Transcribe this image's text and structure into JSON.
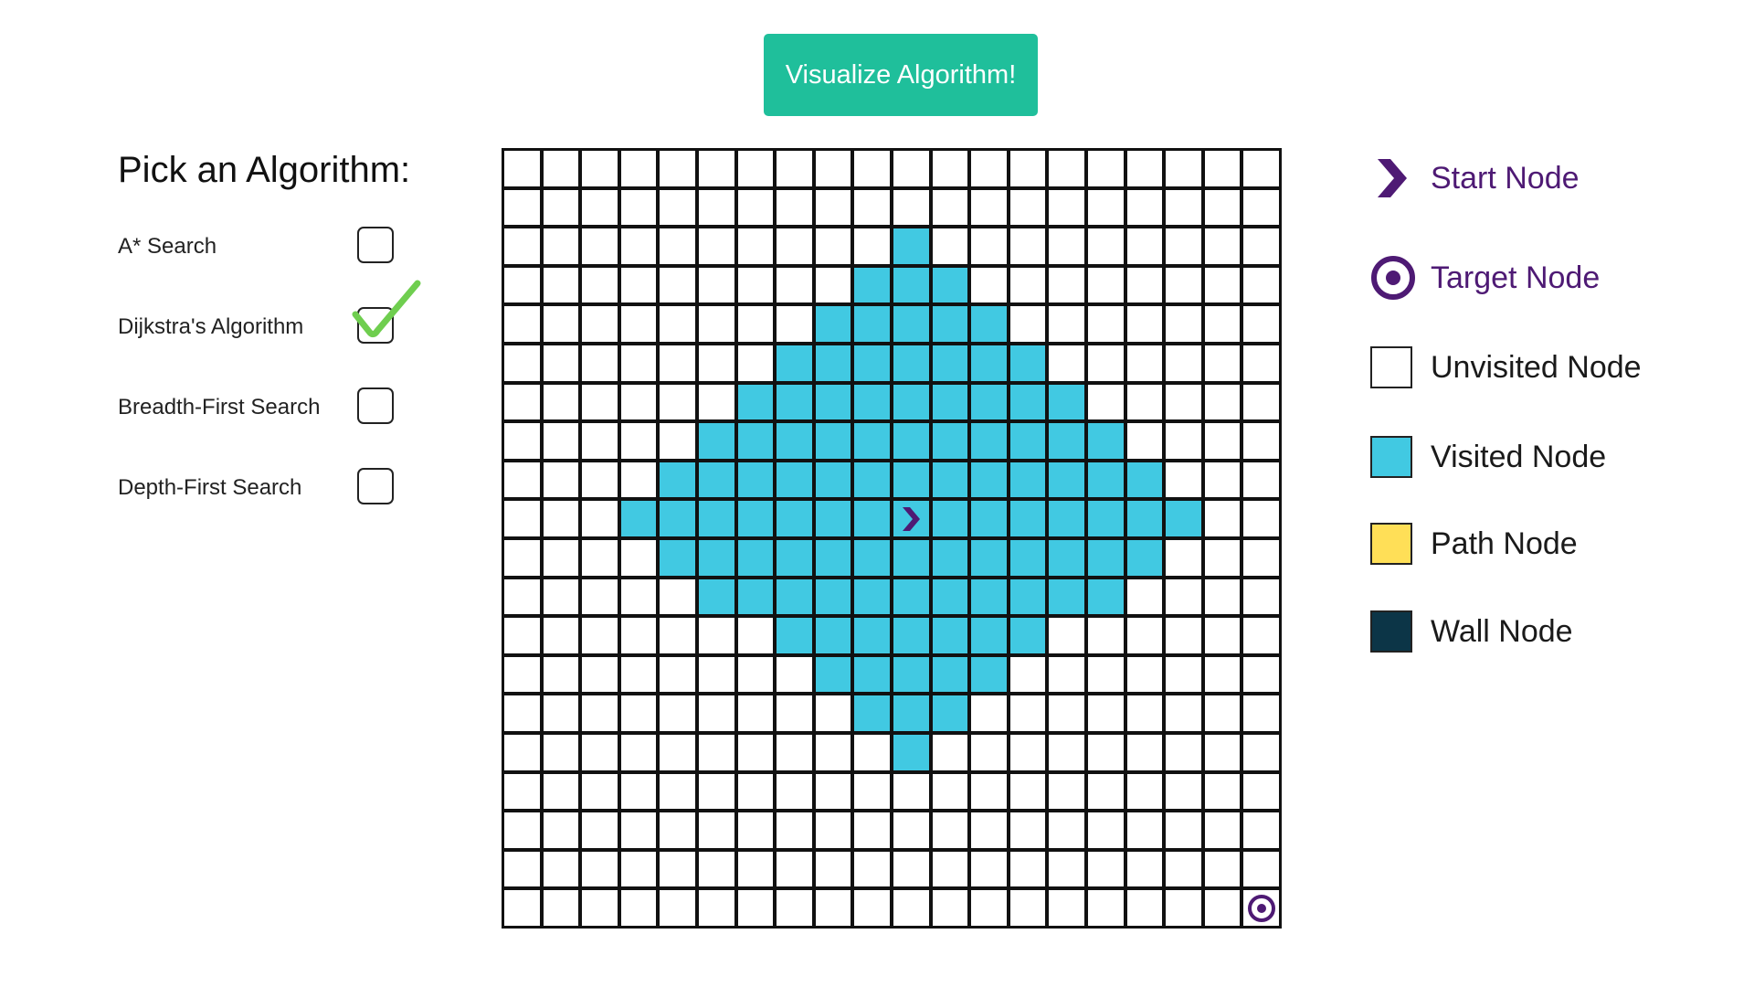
{
  "header": {
    "visualize_label": "Visualize Algorithm!"
  },
  "algorithms": {
    "title": "Pick an Algorithm:",
    "items": [
      {
        "label": "A* Search",
        "checked": false
      },
      {
        "label": "Dijkstra's Algorithm",
        "checked": true
      },
      {
        "label": "Breadth-First Search",
        "checked": false
      },
      {
        "label": "Depth-First Search",
        "checked": false
      }
    ]
  },
  "grid": {
    "rows": 20,
    "cols": 20,
    "start": [
      9,
      10
    ],
    "target": [
      19,
      19
    ],
    "visited_cells": [
      [
        2,
        10
      ],
      [
        3,
        9
      ],
      [
        3,
        10
      ],
      [
        3,
        11
      ],
      [
        4,
        8
      ],
      [
        4,
        9
      ],
      [
        4,
        10
      ],
      [
        4,
        11
      ],
      [
        4,
        12
      ],
      [
        5,
        7
      ],
      [
        5,
        8
      ],
      [
        5,
        9
      ],
      [
        5,
        10
      ],
      [
        5,
        11
      ],
      [
        5,
        12
      ],
      [
        5,
        13
      ],
      [
        6,
        6
      ],
      [
        6,
        7
      ],
      [
        6,
        8
      ],
      [
        6,
        9
      ],
      [
        6,
        10
      ],
      [
        6,
        11
      ],
      [
        6,
        12
      ],
      [
        6,
        13
      ],
      [
        6,
        14
      ],
      [
        7,
        5
      ],
      [
        7,
        6
      ],
      [
        7,
        7
      ],
      [
        7,
        8
      ],
      [
        7,
        9
      ],
      [
        7,
        10
      ],
      [
        7,
        11
      ],
      [
        7,
        12
      ],
      [
        7,
        13
      ],
      [
        7,
        14
      ],
      [
        7,
        15
      ],
      [
        8,
        4
      ],
      [
        8,
        5
      ],
      [
        8,
        6
      ],
      [
        8,
        7
      ],
      [
        8,
        8
      ],
      [
        8,
        9
      ],
      [
        8,
        10
      ],
      [
        8,
        11
      ],
      [
        8,
        12
      ],
      [
        8,
        13
      ],
      [
        8,
        14
      ],
      [
        8,
        15
      ],
      [
        8,
        16
      ],
      [
        9,
        3
      ],
      [
        9,
        4
      ],
      [
        9,
        5
      ],
      [
        9,
        6
      ],
      [
        9,
        7
      ],
      [
        9,
        8
      ],
      [
        9,
        9
      ],
      [
        9,
        10
      ],
      [
        9,
        11
      ],
      [
        9,
        12
      ],
      [
        9,
        13
      ],
      [
        9,
        14
      ],
      [
        9,
        15
      ],
      [
        9,
        16
      ],
      [
        9,
        17
      ],
      [
        10,
        4
      ],
      [
        10,
        5
      ],
      [
        10,
        6
      ],
      [
        10,
        7
      ],
      [
        10,
        8
      ],
      [
        10,
        9
      ],
      [
        10,
        10
      ],
      [
        10,
        11
      ],
      [
        10,
        12
      ],
      [
        10,
        13
      ],
      [
        10,
        14
      ],
      [
        10,
        15
      ],
      [
        10,
        16
      ],
      [
        11,
        5
      ],
      [
        11,
        6
      ],
      [
        11,
        7
      ],
      [
        11,
        8
      ],
      [
        11,
        9
      ],
      [
        11,
        10
      ],
      [
        11,
        11
      ],
      [
        11,
        12
      ],
      [
        11,
        13
      ],
      [
        11,
        14
      ],
      [
        11,
        15
      ],
      [
        12,
        7
      ],
      [
        12,
        8
      ],
      [
        12,
        9
      ],
      [
        12,
        10
      ],
      [
        12,
        11
      ],
      [
        12,
        12
      ],
      [
        12,
        13
      ],
      [
        13,
        8
      ],
      [
        13,
        9
      ],
      [
        13,
        10
      ],
      [
        13,
        11
      ],
      [
        13,
        12
      ],
      [
        14,
        9
      ],
      [
        14,
        10
      ],
      [
        14,
        11
      ],
      [
        15,
        10
      ]
    ],
    "path_cells": [],
    "wall_cells": []
  },
  "legend": {
    "items": [
      {
        "label": "Start Node",
        "kind": "start",
        "icon": "chevron-right-icon"
      },
      {
        "label": "Target Node",
        "kind": "target",
        "icon": "target-icon"
      },
      {
        "label": "Unvisited Node",
        "kind": "unvisited",
        "color": "#ffffff"
      },
      {
        "label": "Visited Node",
        "kind": "visited",
        "color": "#41c9e2"
      },
      {
        "label": "Path Node",
        "kind": "path",
        "color": "#ffdf57"
      },
      {
        "label": "Wall Node",
        "kind": "wall",
        "color": "#0c3547"
      }
    ]
  },
  "colors": {
    "accent": "#1fbf9b",
    "node_icon": "#4e1a74",
    "check": "#6fce4f",
    "grid_line": "#111111"
  }
}
